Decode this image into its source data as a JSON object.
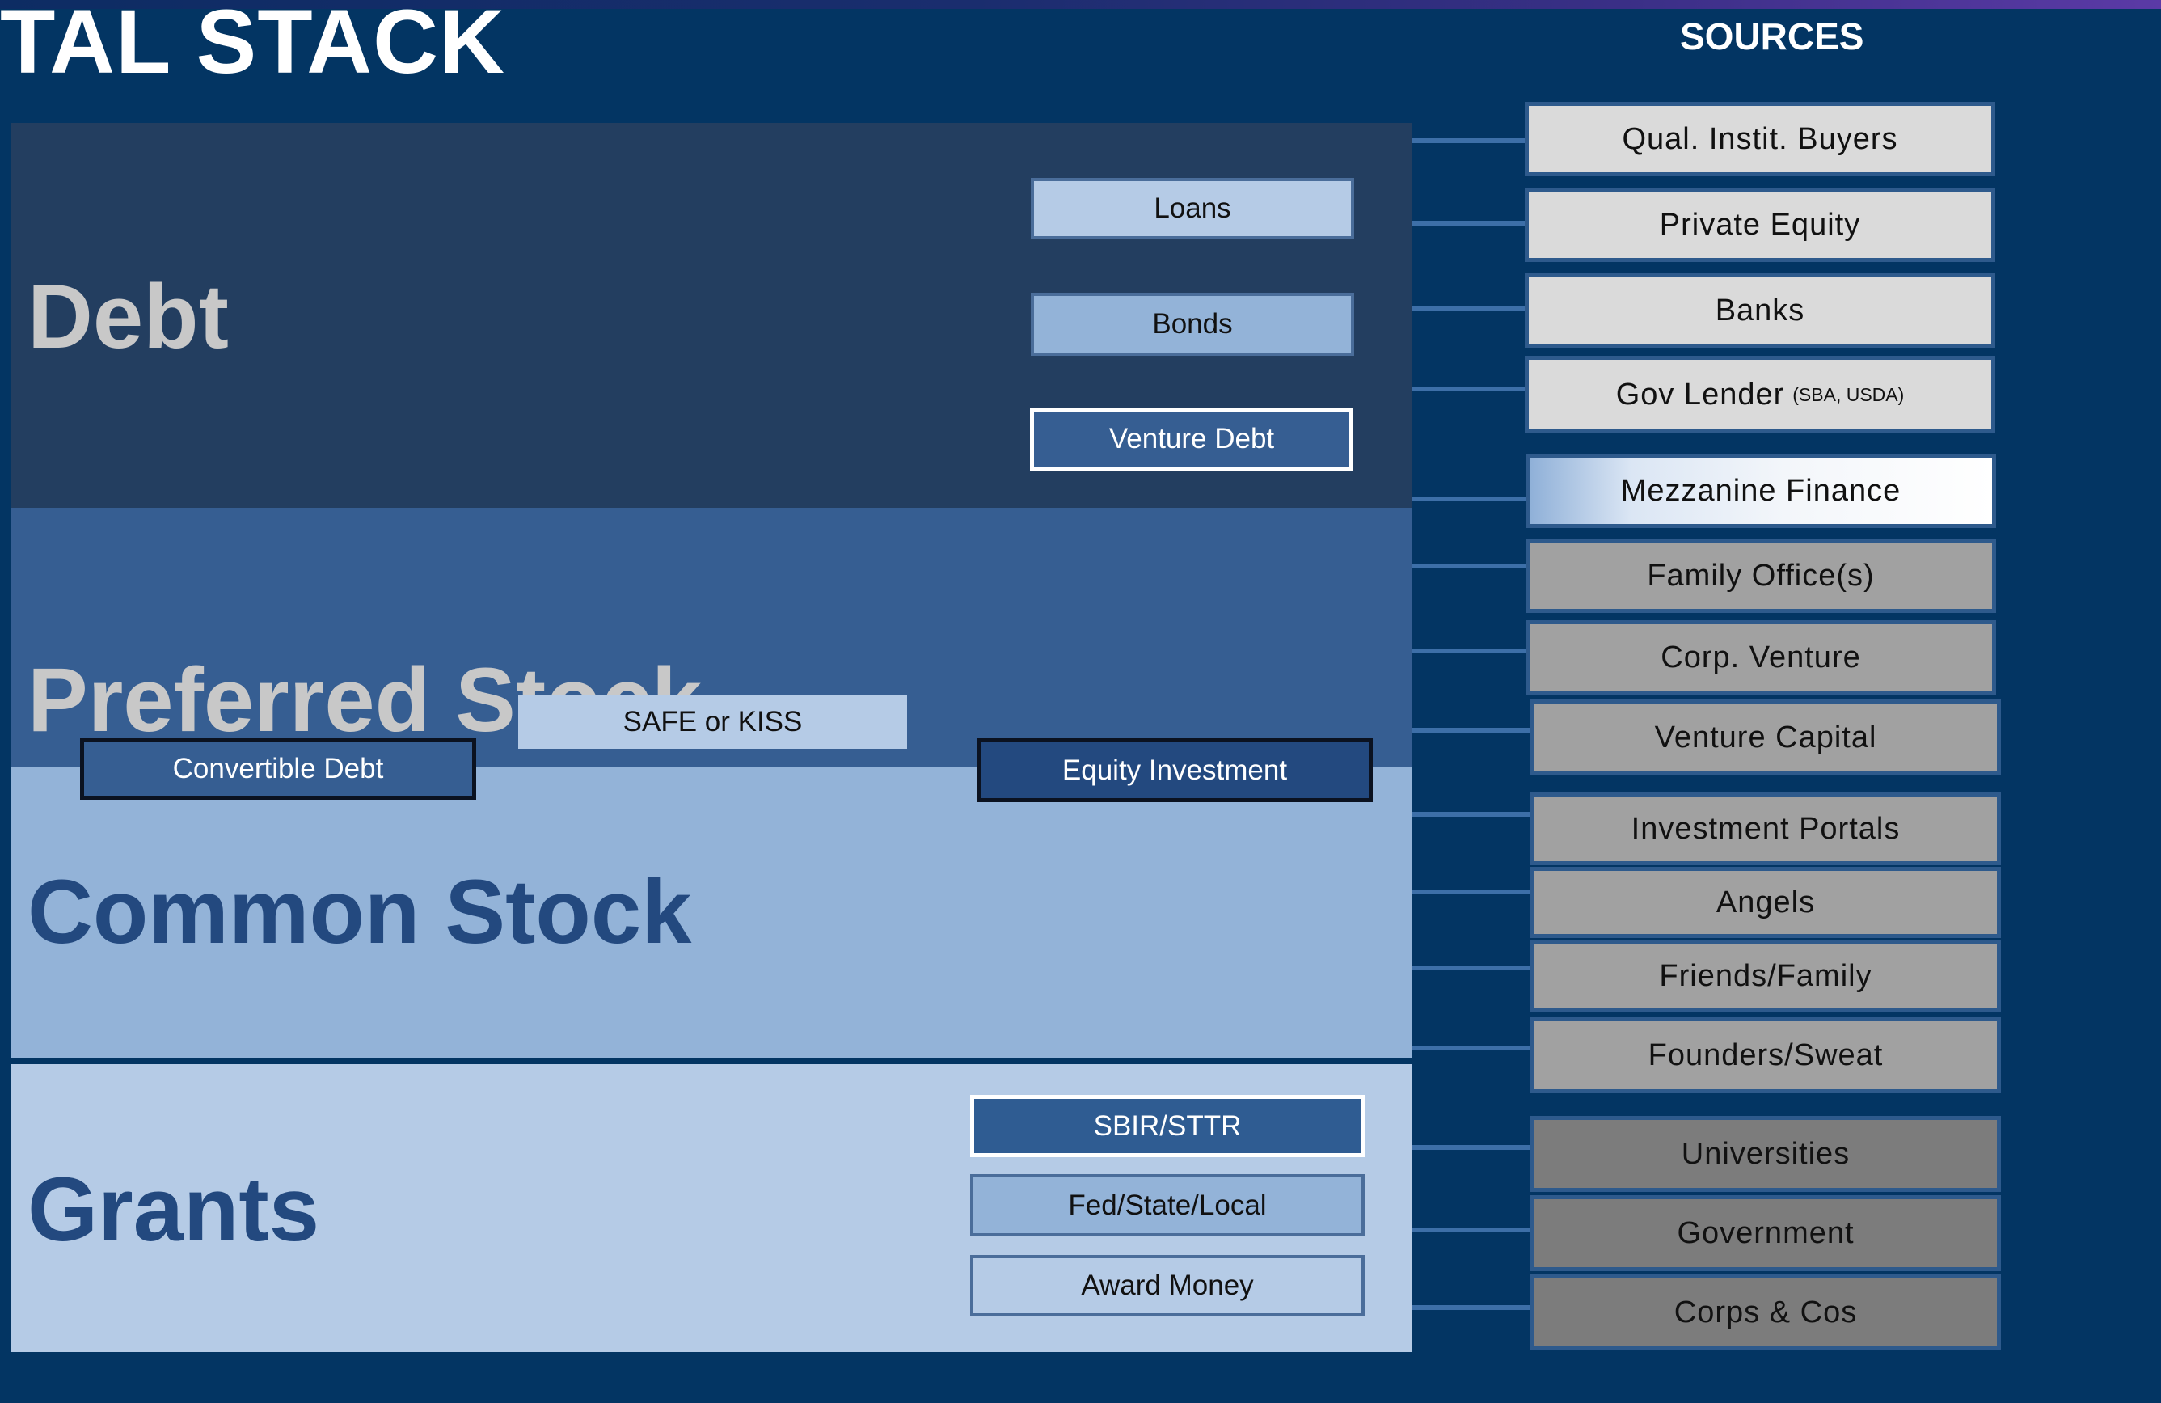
{
  "title": "TAL STACK",
  "sources_heading": "SOURCES",
  "bands": {
    "debt": "Debt",
    "preferred": "Preferred Stock",
    "common": "Common Stock",
    "grants": "Grants"
  },
  "instruments": {
    "loans": "Loans",
    "bonds": "Bonds",
    "venture_debt": "Venture Debt",
    "safe_kiss": "SAFE or KISS",
    "convertible_debt": "Convertible Debt",
    "equity_investment": "Equity Investment",
    "sbir": "SBIR/STTR",
    "fed_state_local": "Fed/State/Local",
    "award_money": "Award Money"
  },
  "sources": [
    {
      "label": "Qual. Instit. Buyers",
      "note": "",
      "shade": "light"
    },
    {
      "label": "Private Equity",
      "note": "",
      "shade": "light"
    },
    {
      "label": "Banks",
      "note": "",
      "shade": "light"
    },
    {
      "label": "Gov Lender",
      "note": "(SBA, USDA)",
      "shade": "light"
    },
    {
      "label": "Mezzanine Finance",
      "note": "",
      "shade": "gradient"
    },
    {
      "label": "Family Office(s)",
      "note": "",
      "shade": "mid"
    },
    {
      "label": "Corp. Venture",
      "note": "",
      "shade": "mid"
    },
    {
      "label": "Venture Capital",
      "note": "",
      "shade": "mid"
    },
    {
      "label": "Investment Portals",
      "note": "",
      "shade": "mid"
    },
    {
      "label": "Angels",
      "note": "",
      "shade": "mid"
    },
    {
      "label": "Friends/Family",
      "note": "",
      "shade": "mid"
    },
    {
      "label": "Founders/Sweat",
      "note": "",
      "shade": "mid"
    },
    {
      "label": "Universities",
      "note": "",
      "shade": "dark"
    },
    {
      "label": "Government",
      "note": "",
      "shade": "dark"
    },
    {
      "label": "Corps & Cos",
      "note": "",
      "shade": "dark"
    }
  ],
  "colors": {
    "background": "#033563",
    "debt_band": "#233e60",
    "preferred_band": "#365e92",
    "common_band": "#93b3d8",
    "grants_band": "#b5cbe6",
    "connector": "#3d6fa8"
  }
}
